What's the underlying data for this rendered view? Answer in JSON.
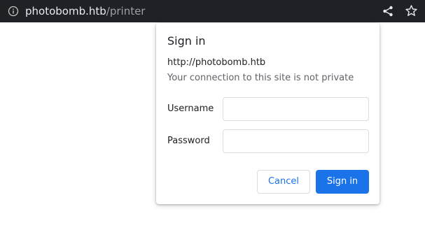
{
  "address_bar": {
    "host": "photobomb.htb",
    "path": "/printer",
    "icons": {
      "site_info": "info-icon",
      "share": "share-icon",
      "bookmark": "star-icon"
    }
  },
  "dialog": {
    "title": "Sign in",
    "origin": "http://photobomb.htb",
    "warning": "Your connection to this site is not private",
    "username_label": "Username",
    "username_value": "",
    "password_label": "Password",
    "password_value": "",
    "cancel_label": "Cancel",
    "signin_label": "Sign in"
  },
  "colors": {
    "toolbar_bg": "#202124",
    "accent": "#1a73e8",
    "secondary_text": "#5f6368"
  }
}
